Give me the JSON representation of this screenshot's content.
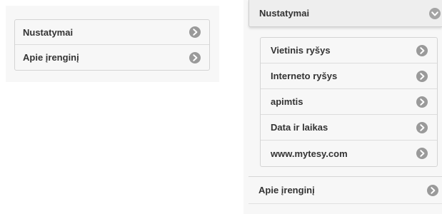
{
  "left_menu": {
    "items": [
      {
        "label": "Nustatymai",
        "icon": "chevron-right-icon"
      },
      {
        "label": "Apie įrenginį",
        "icon": "chevron-right-icon"
      }
    ]
  },
  "right_menu": {
    "header": {
      "label": "Nustatymai",
      "icon": "chevron-down-icon",
      "expanded": true
    },
    "subitems": [
      {
        "label": "Vietinis ryšys",
        "icon": "chevron-right-icon"
      },
      {
        "label": "Interneto ryšys",
        "icon": "chevron-right-icon"
      },
      {
        "label": "apimtis",
        "icon": "chevron-right-icon"
      },
      {
        "label": "Data ir laikas",
        "icon": "chevron-right-icon"
      },
      {
        "label": "www.mytesy.com",
        "icon": "chevron-right-icon"
      }
    ],
    "bottom_item": {
      "label": "Apie įrenginį",
      "icon": "chevron-right-icon"
    }
  },
  "colors": {
    "text": "#333333",
    "icon_bg": "#9a9a9a",
    "panel_bg": "#f7f7f7",
    "header_bg": "#eeeeee",
    "border": "#d4d4d4"
  }
}
